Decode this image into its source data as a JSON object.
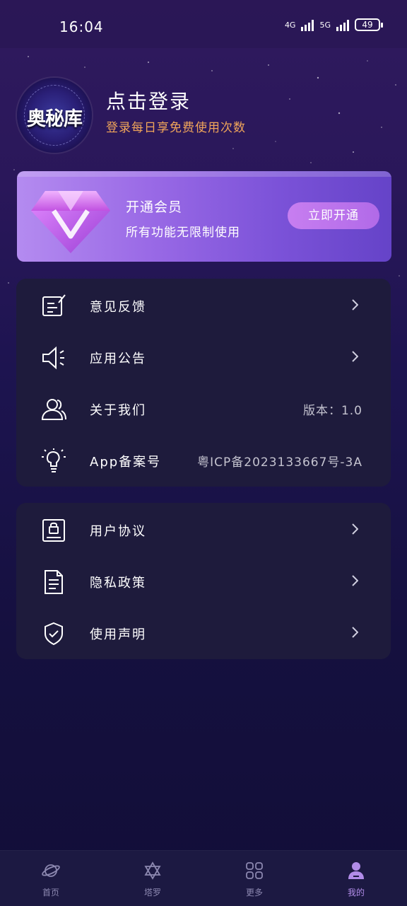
{
  "status_bar": {
    "time": "16:04",
    "network_1": "4G",
    "network_2": "5G",
    "battery": "49"
  },
  "profile": {
    "avatar_text": "奥秘库",
    "login_title": "点击登录",
    "login_subtitle": "登录每日享免费使用次数"
  },
  "vip": {
    "title": "开通会员",
    "subtitle": "所有功能无限制使用",
    "button_label": "立即开通"
  },
  "menu_group_1": [
    {
      "label": "意见反馈",
      "icon": "feedback-icon",
      "value": ""
    },
    {
      "label": "应用公告",
      "icon": "speaker-icon",
      "value": ""
    },
    {
      "label": "关于我们",
      "icon": "users-icon",
      "value": "版本：1.0"
    },
    {
      "label": "App备案号",
      "icon": "lightbulb-icon",
      "value": "粤ICP备2023133667号-3A"
    }
  ],
  "menu_group_2": [
    {
      "label": "用户协议",
      "icon": "agreement-icon"
    },
    {
      "label": "隐私政策",
      "icon": "document-icon"
    },
    {
      "label": "使用声明",
      "icon": "shield-check-icon"
    }
  ],
  "bottom_nav": [
    {
      "label": "首页",
      "icon": "planet-icon"
    },
    {
      "label": "塔罗",
      "icon": "star-of-david-icon"
    },
    {
      "label": "更多",
      "icon": "grid-icon"
    },
    {
      "label": "我的",
      "icon": "profile-icon",
      "active": true
    }
  ],
  "colors": {
    "accent": "#b18ce8",
    "subtitle": "#f0a55a",
    "card_bg": "#1e1b3c"
  }
}
